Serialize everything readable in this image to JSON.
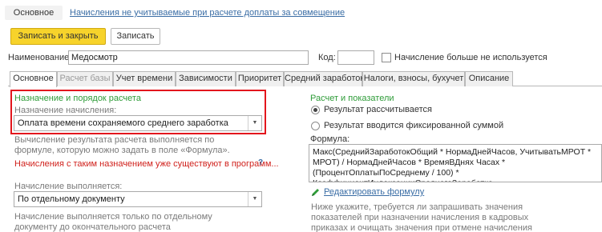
{
  "topnav": {
    "main_tab": "Основное",
    "link": "Начисления не учитываемые при расчете доплаты за совмещение"
  },
  "toolbar": {
    "save_close": "Записать и закрыть",
    "save": "Записать"
  },
  "name_row": {
    "name_label": "Наименование:",
    "name_value": "Медосмотр",
    "code_label": "Код:",
    "code_value": "",
    "unused_label": "Начисление больше не используется"
  },
  "tabs": [
    {
      "label": "Основное"
    },
    {
      "label": "Расчет базы"
    },
    {
      "label": "Учет времени"
    },
    {
      "label": "Зависимости"
    },
    {
      "label": "Приоритет"
    },
    {
      "label": "Средний заработок"
    },
    {
      "label": "Налоги, взносы, бухучет"
    },
    {
      "label": "Описание"
    }
  ],
  "left": {
    "section_title": "Назначение и порядок расчета",
    "purpose_label": "Назначение начисления:",
    "purpose_value": "Оплата времени сохраняемого среднего заработка",
    "purpose_hint": "Вычисление результата расчета выполняется по формуле, которую можно задать в поле «Формула».",
    "warning": "Начисления с таким назначением уже существуют в программ...",
    "help": "?",
    "execution_label": "Начисление выполняется:",
    "execution_value": "По отдельному документу",
    "execution_hint": "Начисление выполняется только по отдельному документу до окончательного расчета"
  },
  "right": {
    "section_title": "Расчет и показатели",
    "radio_calculated": "Результат рассчитывается",
    "radio_fixed": "Результат вводится фиксированной суммой",
    "formula_label": "Формула:",
    "formula_value": "Макс(СреднийЗаработокОбщий * НормаДнейЧасов, УчитыватьМРОТ * МРОТ) / НормаДнейЧасов * ВремяВДнях Часах * (ПроцентОплатыПоСреднему / 100) * КоэффициентИндексацииСреднегоЗаработка",
    "edit_formula": "Редактировать формулу",
    "hint": "Ниже укажите, требуется ли запрашивать значения показателей при назначении начисления в кадровых приказах и очищать значения при отмене начисления"
  },
  "colors": {
    "accent_yellow": "#f7d32b",
    "link_blue": "#3a6da5",
    "section_green": "#2f9c39",
    "warning_red": "#d0211c",
    "highlight_red": "#e3161d"
  }
}
